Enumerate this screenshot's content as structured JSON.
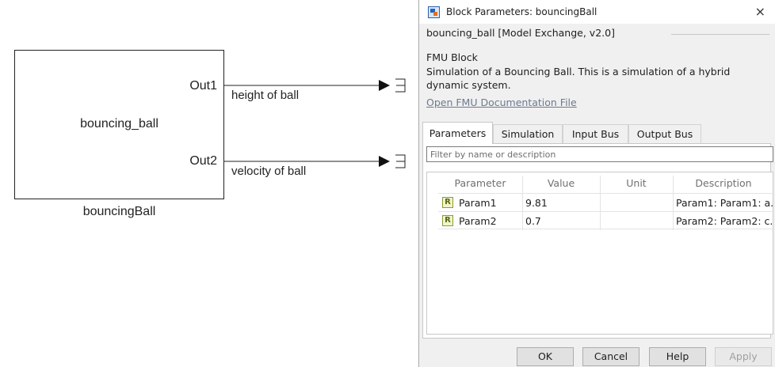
{
  "canvas": {
    "block_name": "bouncing_ball",
    "block_caption": "bouncingBall",
    "ports": [
      {
        "label": "Out1",
        "signal": "height of ball"
      },
      {
        "label": "Out2",
        "signal": "velocity of ball"
      }
    ]
  },
  "dialog": {
    "title": "Block Parameters: bouncingBall",
    "close_glyph": "×",
    "group_label": "bouncing_ball [Model Exchange, v2.0]",
    "block_type": "FMU Block",
    "description": "Simulation of a Bouncing Ball. This is a simulation of a hybrid dynamic system.",
    "doc_link": "Open FMU Documentation File",
    "tabs": [
      "Parameters",
      "Simulation",
      "Input Bus",
      "Output Bus"
    ],
    "active_tab": "Parameters",
    "filter_placeholder": "Filter by name or description",
    "columns": [
      "Parameter",
      "Value",
      "Unit",
      "Description"
    ],
    "rows": [
      {
        "icon": "R",
        "name": "Param1",
        "value": "9.81",
        "unit": "",
        "description": "Param1: Param1: a..."
      },
      {
        "icon": "R",
        "name": "Param2",
        "value": "0.7",
        "unit": "",
        "description": "Param2: Param2: c..."
      }
    ],
    "buttons": {
      "ok": "OK",
      "cancel": "Cancel",
      "help": "Help",
      "apply": "Apply"
    }
  }
}
